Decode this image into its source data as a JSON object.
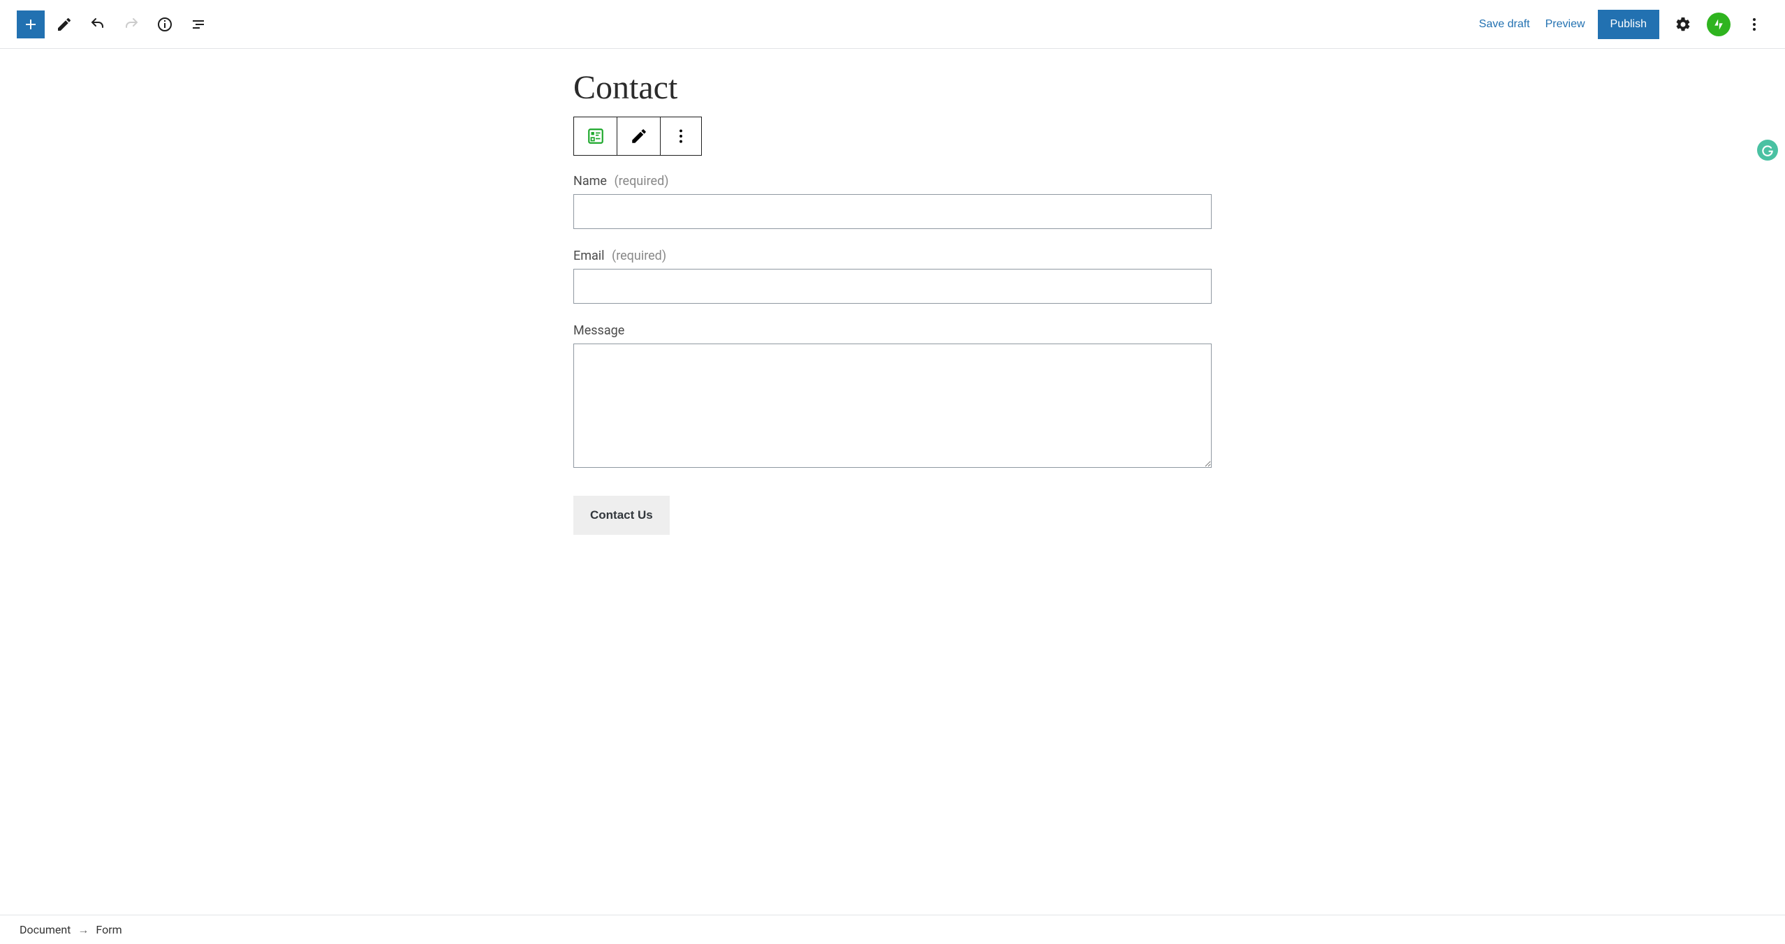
{
  "topbar": {
    "save_draft": "Save draft",
    "preview": "Preview",
    "publish": "Publish"
  },
  "page": {
    "title": "Contact"
  },
  "form": {
    "fields": [
      {
        "label": "Name",
        "required_hint": "(required)",
        "required": true,
        "type": "text",
        "value": ""
      },
      {
        "label": "Email",
        "required_hint": "(required)",
        "required": true,
        "type": "text",
        "value": ""
      },
      {
        "label": "Message",
        "required_hint": "",
        "required": false,
        "type": "textarea",
        "value": ""
      }
    ],
    "submit_label": "Contact Us"
  },
  "breadcrumb": {
    "parent": "Document",
    "sep": "→",
    "current": "Form"
  }
}
